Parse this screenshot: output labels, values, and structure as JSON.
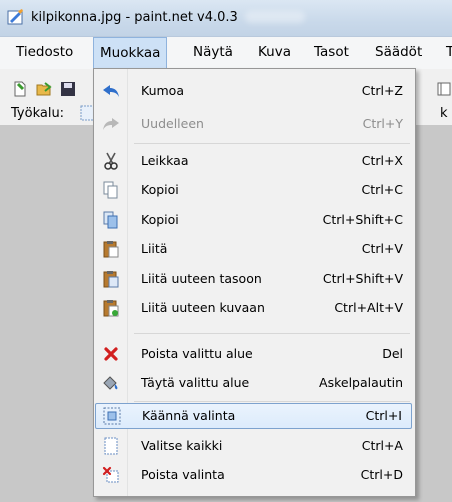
{
  "window": {
    "title": "kilpikonna.jpg - paint.net v4.0.3"
  },
  "menubar": {
    "items": [
      {
        "label": "Tiedosto"
      },
      {
        "label": "Muokkaa"
      },
      {
        "label": "Näytä"
      },
      {
        "label": "Kuva"
      },
      {
        "label": "Tasot"
      },
      {
        "label": "Säädöt"
      },
      {
        "label": "T"
      }
    ]
  },
  "toolbar": {
    "tool_label": "Työkalu:",
    "cut_text": "k"
  },
  "menu": {
    "items": [
      {
        "label": "Kumoa",
        "shortcut": "Ctrl+Z",
        "icon": "undo-icon"
      },
      {
        "label": "Uudelleen",
        "shortcut": "Ctrl+Y",
        "icon": "redo-icon",
        "disabled": true
      },
      {
        "label": "Leikkaa",
        "shortcut": "Ctrl+X",
        "icon": "scissors-icon"
      },
      {
        "label": "Kopioi",
        "shortcut": "Ctrl+C",
        "icon": "copy-icon"
      },
      {
        "label": "Kopioi",
        "shortcut": "Ctrl+Shift+C",
        "icon": "copy-merged-icon"
      },
      {
        "label": "Liitä",
        "shortcut": "Ctrl+V",
        "icon": "paste-icon"
      },
      {
        "label": "Liitä uuteen tasoon",
        "shortcut": "Ctrl+Shift+V",
        "icon": "paste-new-layer-icon"
      },
      {
        "label": "Liitä uuteen kuvaan",
        "shortcut": "Ctrl+Alt+V",
        "icon": "paste-new-image-icon"
      },
      {
        "label": "Poista valittu alue",
        "shortcut": "Del",
        "icon": "delete-icon"
      },
      {
        "label": "Täytä valittu alue",
        "shortcut": "Askelpalautin",
        "icon": "fill-icon"
      },
      {
        "label": "Käännä valinta",
        "shortcut": "Ctrl+I",
        "icon": "invert-selection-icon",
        "highlighted": true
      },
      {
        "label": "Valitse kaikki",
        "shortcut": "Ctrl+A",
        "icon": "select-all-icon"
      },
      {
        "label": "Poista valinta",
        "shortcut": "Ctrl+D",
        "icon": "deselect-icon"
      }
    ]
  }
}
